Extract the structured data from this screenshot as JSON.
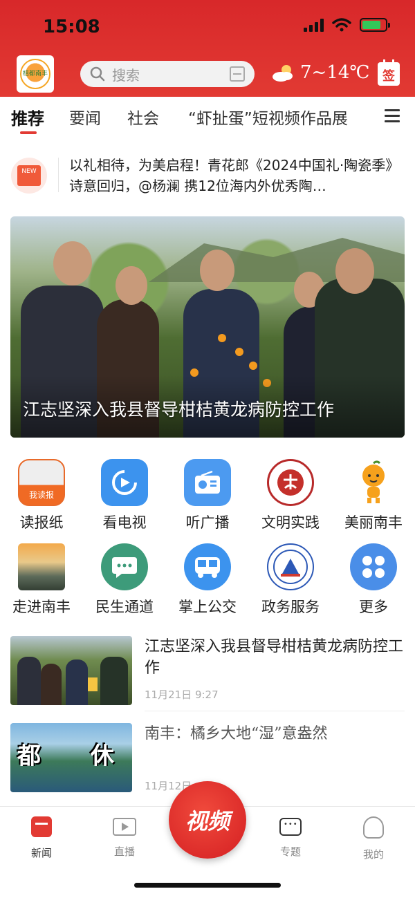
{
  "status_bar": {
    "time": "15:08"
  },
  "header": {
    "logo_text": "桔都南丰",
    "search_placeholder": "搜索",
    "weather": "7~14℃",
    "checkin_label": "签"
  },
  "tabs": [
    "推荐",
    "要闻",
    "社会",
    "“虾扯蛋”短视频作品展"
  ],
  "marquee": {
    "badge_text": "NEW",
    "text": "以礼相待，为美启程！青花郎《2024中国礼·陶瓷季》诗意回归，@杨澜 携12位海内外优秀陶…"
  },
  "hero": {
    "title": "江志坚深入我县督导柑桔黄龙病防控工作"
  },
  "grid": [
    {
      "label": "读报纸",
      "icon": "newspaper-icon",
      "icon_text": "我读报"
    },
    {
      "label": "看电视",
      "icon": "tv-play-icon"
    },
    {
      "label": "听广播",
      "icon": "radio-icon"
    },
    {
      "label": "文明实践",
      "icon": "civilization-seal-icon"
    },
    {
      "label": "美丽南丰",
      "icon": "orange-mascot-icon"
    },
    {
      "label": "走进南丰",
      "icon": "sunrise-landscape-icon"
    },
    {
      "label": "民生通道",
      "icon": "chat-bubble-icon"
    },
    {
      "label": "掌上公交",
      "icon": "bus-icon"
    },
    {
      "label": "政务服务",
      "icon": "government-seal-icon"
    },
    {
      "label": "更多",
      "icon": "four-petal-more-icon"
    }
  ],
  "news": [
    {
      "title": "江志坚深入我县督导柑桔黄龙病防控工作",
      "time": "11月21日  9:27"
    },
    {
      "title": "南丰：橘乡大地“湿”意盎然",
      "time": "11月12日",
      "thumb_text": "都 休"
    }
  ],
  "bottom_nav": {
    "items": [
      {
        "label": "新闻",
        "icon": "news-icon",
        "active": true
      },
      {
        "label": "直播",
        "icon": "live-icon",
        "active": false
      },
      {
        "label": "专题",
        "icon": "topic-icon",
        "active": false
      },
      {
        "label": "我的",
        "icon": "profile-icon",
        "active": false
      }
    ],
    "video_label": "视频"
  },
  "colors": {
    "brand_red": "#e23a33",
    "text": "#222222",
    "muted": "#aaaaaa"
  }
}
